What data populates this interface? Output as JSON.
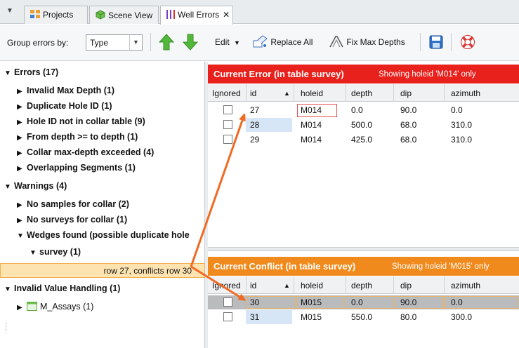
{
  "tabs": [
    {
      "label": "Projects"
    },
    {
      "label": "Scene View"
    },
    {
      "label": "Well Errors",
      "close": "✕"
    }
  ],
  "toolbar": {
    "group_label": "Group errors by:",
    "group_value": "Type",
    "edit_label": "Edit",
    "replace_all_label": "Replace All",
    "fix_max_depths_label": "Fix Max Depths"
  },
  "tree": {
    "errors_header": "Errors (17)",
    "errors": [
      "Invalid Max Depth (1)",
      "Duplicate Hole ID (1)",
      "Hole ID not in collar table (9)",
      "From depth >= to depth (1)",
      "Collar max-depth exceeded (4)",
      "Overlapping Segments (1)"
    ],
    "warnings_header": "Warnings (4)",
    "warnings": [
      "No samples for collar (2)",
      "No surveys for collar (1)",
      "Wedges found (possible duplicate hole"
    ],
    "survey_label": "survey (1)",
    "selected_item": "row 27, conflicts row 30",
    "invalid_header": "Invalid Value Handling (1)",
    "assays_label": "M_Assays (1)"
  },
  "current_error": {
    "title": "Current Error (in table survey)",
    "subtitle": "Showing holeid 'M014' only",
    "color": "#e8211c",
    "columns": [
      "Ignored",
      "id",
      "holeid",
      "depth",
      "dip",
      "azimuth"
    ],
    "rows": [
      {
        "id": "27",
        "holeid": "M014",
        "depth": "0.0",
        "dip": "90.0",
        "azimuth": "0.0"
      },
      {
        "id": "28",
        "holeid": "M014",
        "depth": "500.0",
        "dip": "68.0",
        "azimuth": "310.0"
      },
      {
        "id": "29",
        "holeid": "M014",
        "depth": "425.0",
        "dip": "68.0",
        "azimuth": "310.0"
      }
    ]
  },
  "current_conflict": {
    "title": "Current Conflict (in table survey)",
    "subtitle": "Showing holeid 'M015' only",
    "color": "#f18a1c",
    "columns": [
      "Ignored",
      "id",
      "holeid",
      "depth",
      "dip",
      "azimuth"
    ],
    "rows": [
      {
        "id": "30",
        "holeid": "M015",
        "depth": "0.0",
        "dip": "90.0",
        "azimuth": "0.0"
      },
      {
        "id": "31",
        "holeid": "M015",
        "depth": "550.0",
        "dip": "80.0",
        "azimuth": "300.0"
      }
    ]
  },
  "colors": {
    "callout_arrow": "#f06a22",
    "selection": "#fde3b0"
  }
}
